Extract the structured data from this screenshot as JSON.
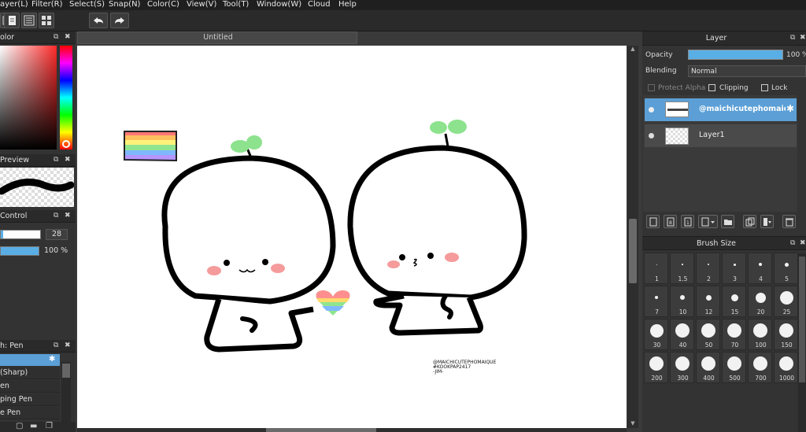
{
  "menu": {
    "items": [
      "ayer(L)",
      "Filter(R)",
      "Select(S)",
      "Snap(N)",
      "Color(C)",
      "View(V)",
      "Tool(T)",
      "Window(W)",
      "Cloud",
      "Help"
    ]
  },
  "document": {
    "tab_title": "Untitled"
  },
  "left_panels": {
    "color": {
      "title": "olor"
    },
    "preview": {
      "title": "Preview"
    },
    "control": {
      "title": "Control",
      "size_value": "28",
      "opacity_value": "100 %"
    },
    "brush": {
      "title": "h: Pen",
      "items": [
        "(Sharp)",
        "en",
        "ping Pen",
        "e Pen"
      ]
    }
  },
  "layer_panel": {
    "title": "Layer",
    "opacity_label": "Opacity",
    "opacity_value": "100 %",
    "blending_label": "Blending",
    "blending_value": "Normal",
    "protect_alpha": "Protect Alpha",
    "clipping": "Clipping",
    "lock": "Lock",
    "layers": [
      {
        "name": "@maichicutephomaique",
        "selected": true
      },
      {
        "name": "Layer1",
        "selected": false
      }
    ]
  },
  "brush_size": {
    "title": "Brush Size",
    "sizes": [
      "1",
      "1.5",
      "2",
      "3",
      "4",
      "5",
      "7",
      "10",
      "12",
      "15",
      "20",
      "25",
      "30",
      "40",
      "50",
      "70",
      "100",
      "150",
      "200",
      "300",
      "400",
      "500",
      "700",
      "1000"
    ]
  },
  "artwork": {
    "signature_line1": "@MAICHICUTEPHOMAIQUE",
    "signature_line2": "#KOOKPAP2417",
    "signature_line3": "-JIM-"
  },
  "colors": {
    "accent": "#5aaee6",
    "selected_layer": "#5b9fd6",
    "sprout": "#8de28d",
    "blush": "#f59b9b"
  }
}
